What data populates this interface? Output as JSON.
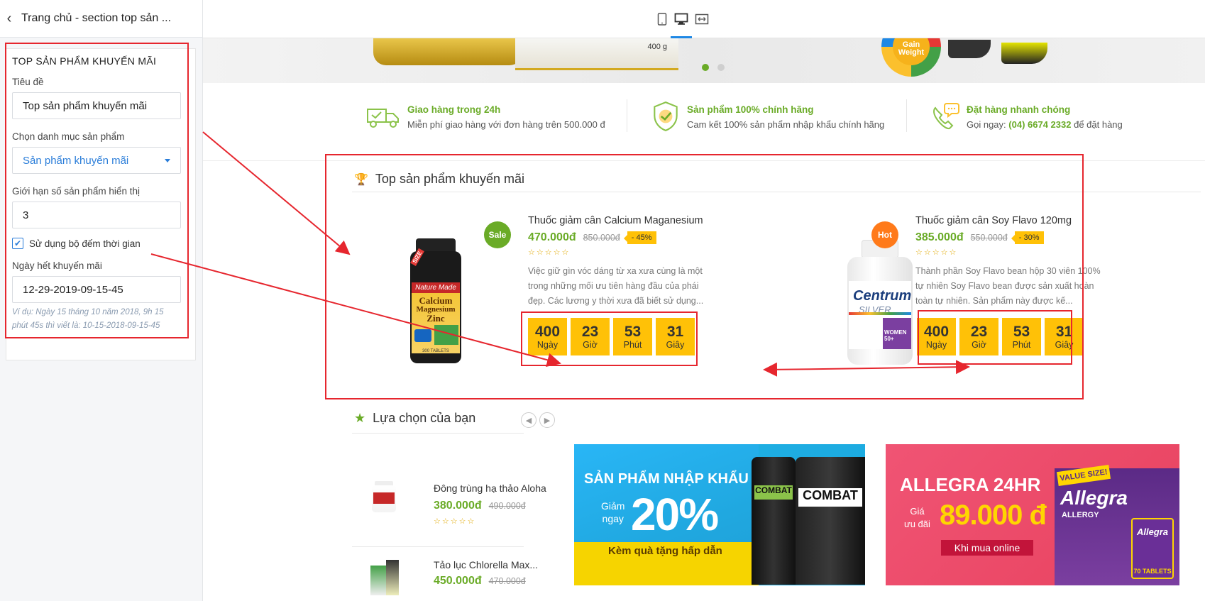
{
  "sidebar": {
    "title": "Trang chủ - section top sản ...",
    "section_heading": "TOP SẢN PHẨM KHUYẾN MÃI",
    "title_label": "Tiêu đề",
    "title_value": "Top sản phẩm khuyến mãi",
    "category_label": "Chọn danh mục sản phẩm",
    "category_value": "Sản phẩm khuyến mãi",
    "limit_label": "Giới hạn số sản phẩm hiển thị",
    "limit_value": "3",
    "timer_label": "Sử dụng bộ đếm thời gian",
    "timer_checked": true,
    "end_label": "Ngày hết khuyến mãi",
    "end_value": "12-29-2019-09-15-45",
    "hint_1": "Ví dụ: Ngày 15 tháng 10 năm 2018, 9h 15",
    "hint_2": "phút 45s thì viết là: 10-15-2018-09-15-45"
  },
  "toolbar": {
    "devices": [
      "tablet-icon",
      "desktop-icon",
      "fullwidth-icon"
    ],
    "active": "desktop-icon"
  },
  "features": [
    {
      "title": "Giao hàng trong 24h",
      "desc": "Miễn phí giao hàng với đơn hàng trên 500.000 đ"
    },
    {
      "title": "Sản phẩm 100% chính hãng",
      "desc": "Cam kết 100% sản phẩm nhập khẩu chính hãng"
    },
    {
      "title": "Đặt hàng nhanh chóng",
      "desc_pre": "Gọi ngay:",
      "phone": "(04) 6674 2332",
      "desc_post": "để đặt hàng"
    }
  ],
  "promo": {
    "title": "Top sản phẩm khuyến mãi",
    "products": [
      {
        "badge": "Sale",
        "badge_color": "#6aab27",
        "name": "Thuốc giảm cân Calcium Maganesium",
        "price": "470.000đ",
        "old_price": "850.000đ",
        "discount": "- 45%",
        "stars": "☆☆☆☆☆",
        "desc": "Việc giữ gìn vóc dáng từ xa xưa cùng là một trong những mối ưu tiên hàng đầu của phái đẹp. Các lương y thời xưa đã biết sử dụng...",
        "countdown": [
          {
            "n": "400",
            "u": "Ngày"
          },
          {
            "n": "23",
            "u": "Giờ"
          },
          {
            "n": "53",
            "u": "Phút"
          },
          {
            "n": "31",
            "u": "Giây"
          }
        ],
        "image_text": [
          "Nature Made",
          "Calcium",
          "Magnesium",
          "Zinc",
          "300 TABLETS",
          "SIZE"
        ]
      },
      {
        "badge": "Hot",
        "badge_color": "#ff7a1a",
        "name": "Thuốc giảm cân Soy Flavo 120mg",
        "price": "385.000đ",
        "old_price": "550.000đ",
        "discount": "- 30%",
        "stars": "☆☆☆☆☆",
        "desc": "Thành phần Soy Flavo bean hộp 30 viên 100% tự nhiên Soy Flavo bean được sản xuất hoàn toàn tự nhiên. Sản phẩm này được kế...",
        "countdown": [
          {
            "n": "400",
            "u": "Ngày"
          },
          {
            "n": "23",
            "u": "Giờ"
          },
          {
            "n": "53",
            "u": "Phút"
          },
          {
            "n": "31",
            "u": "Giây"
          }
        ],
        "image_text": [
          "Centrum",
          "SILVER",
          "WOMEN 50+"
        ]
      }
    ]
  },
  "choice": {
    "title": "Lựa chọn của bạn",
    "items": [
      {
        "name": "Đông trùng hạ thảo Aloha",
        "price": "380.000đ",
        "old_price": "490.000đ",
        "stars": "☆☆☆☆☆"
      },
      {
        "name": "Tảo lục Chlorella Max...",
        "price": "450.000đ",
        "old_price": "470.000đ"
      }
    ]
  },
  "ads": {
    "ad1": {
      "title": "SẢN PHẨM NHẬP KHẨU",
      "pre": "Giảm",
      "pre2": "ngay",
      "big": "20%",
      "sub": "Kèm quà tặng hấp dẫn",
      "brand": "COMBAT"
    },
    "ad2": {
      "title": "ALLEGRA 24HR",
      "pre": "Giá",
      "pre2": "ưu đãi",
      "big": "89.000 đ",
      "cta": "Khi mua online",
      "label1": "VALUE SIZE!",
      "brand": "Allegra",
      "sub_brand": "ALLERGY",
      "tab": "70 TABLETS"
    }
  },
  "banner": {
    "slide_dots": 2,
    "active_dot": 0,
    "badge_text": [
      "Gain",
      "Weight"
    ],
    "label": "400 g"
  }
}
